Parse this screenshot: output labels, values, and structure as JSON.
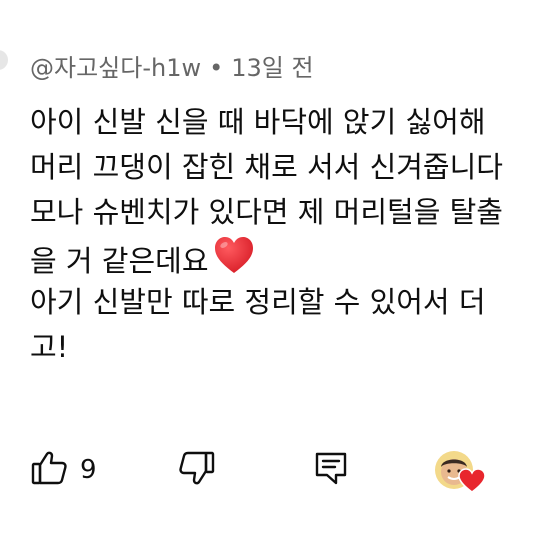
{
  "comment": {
    "author": "@자고싶다-h1w",
    "separator": "•",
    "time": "13일 전",
    "lines": [
      "아이 신발 신을 때 바닥에 앉기 싫어해",
      "머리 끄댕이 잡힌 채로 서서 신겨줍니다",
      "모나 슈벤치가 있다면 제 머리털을 탈출",
      "을 거 같은데요",
      "아기 신발만 따로 정리할 수 있어서 더",
      "고!"
    ],
    "emoji": "red-heart"
  },
  "actions": {
    "like_count": "9",
    "icons": [
      "thumbs-up-icon",
      "thumbs-down-icon",
      "reply-icon",
      "creator-heart-icon"
    ]
  },
  "colors": {
    "text": "#0f0f0f",
    "meta": "#666666",
    "heart": "#e8262d"
  }
}
